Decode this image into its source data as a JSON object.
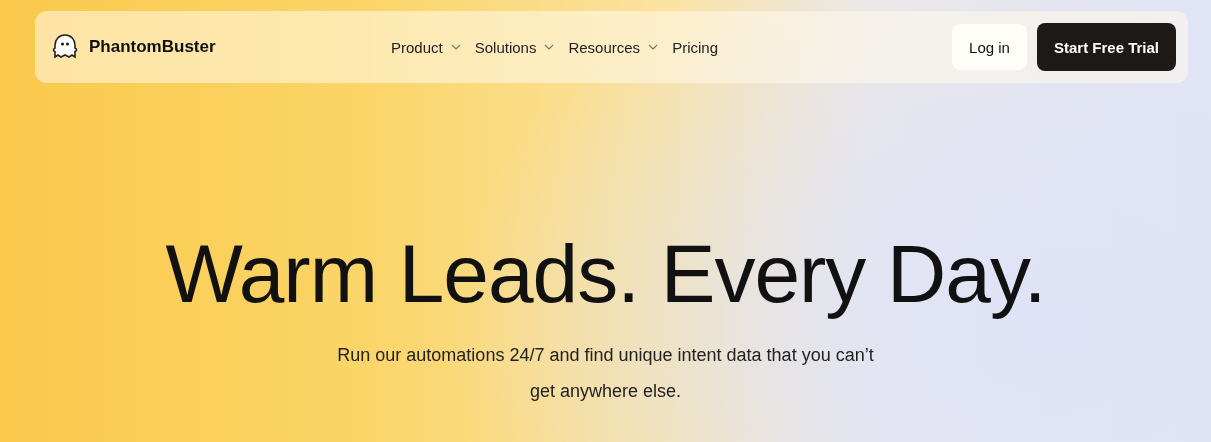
{
  "brand": {
    "name": "PhantomBuster"
  },
  "nav": [
    {
      "label": "Product",
      "kind": "dropdown"
    },
    {
      "label": "Solutions",
      "kind": "dropdown"
    },
    {
      "label": "Resources",
      "kind": "dropdown"
    },
    {
      "label": "Pricing",
      "kind": "link"
    }
  ],
  "actions": {
    "login": "Log in",
    "trial": "Start Free Trial"
  },
  "hero": {
    "title": "Warm Leads. Every Day.",
    "subtitle": "Run our automations 24/7 and find unique intent data that you can’t get anywhere else."
  }
}
